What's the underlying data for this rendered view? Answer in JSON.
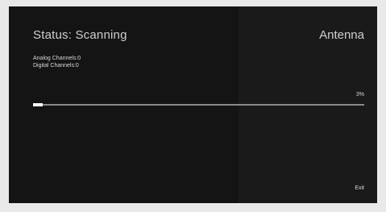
{
  "header": {
    "status": "Status: Scanning",
    "source": "Antenna"
  },
  "channels": {
    "analog": "Analog Channels:0",
    "digital": "Digital Channels:0"
  },
  "progress": {
    "label": "3%",
    "value": 0.03
  },
  "actions": {
    "exit_label": "Exit"
  }
}
